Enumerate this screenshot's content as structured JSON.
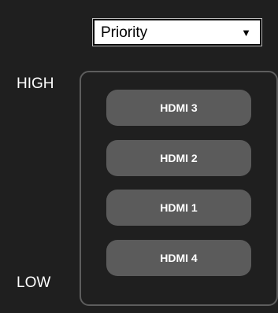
{
  "dropdown": {
    "selected": "Priority",
    "arrow_icon": "dropdown-arrow-icon",
    "arrow_glyph": "▼"
  },
  "priority": {
    "high_label": "HIGH",
    "low_label": "LOW",
    "items": [
      {
        "label": "HDMI 3"
      },
      {
        "label": "HDMI 2"
      },
      {
        "label": "HDMI 1"
      },
      {
        "label": "HDMI 4"
      }
    ]
  },
  "colors": {
    "background": "#1f1f1f",
    "button": "#5b5b5b",
    "frame_border": "#5d5d5d",
    "text": "#ffffff"
  }
}
